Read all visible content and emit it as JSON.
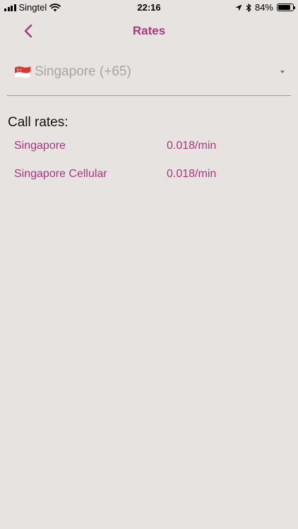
{
  "status_bar": {
    "carrier": "Singtel",
    "time": "22:16",
    "battery": "84%",
    "battery_level": 0.84,
    "icons": [
      "signal-icon",
      "wifi-icon",
      "location-icon",
      "bluetooth-icon",
      "battery-icon"
    ]
  },
  "nav": {
    "title": "Rates",
    "back_icon": "chevron-left-icon"
  },
  "country_select": {
    "value": "Singapore (+65)",
    "flag_icon": "singapore-flag-icon"
  },
  "rates": {
    "title": "Call rates:",
    "rows": [
      {
        "name": "Singapore",
        "rate": "0.018/min"
      },
      {
        "name": "Singapore Cellular",
        "rate": "0.018/min"
      }
    ]
  },
  "colors": {
    "accent": "#a63a7d",
    "background": "#e7e3e0",
    "placeholder_text": "#a9a5a3"
  }
}
